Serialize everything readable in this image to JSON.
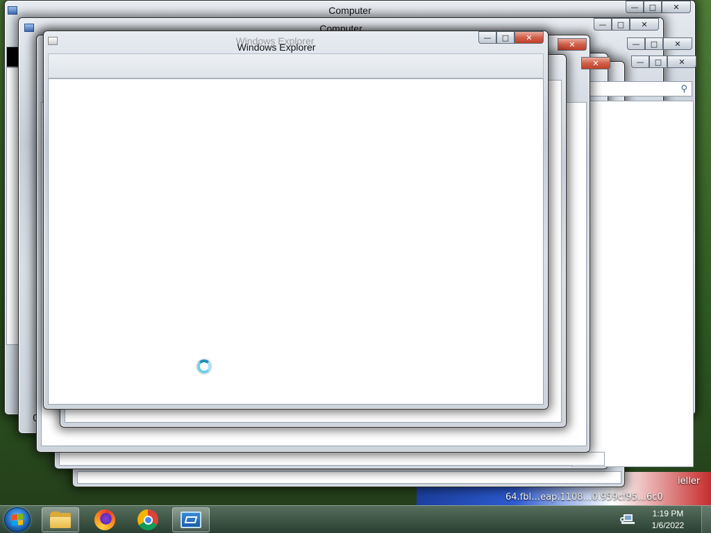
{
  "windows": {
    "back_title": "Computer",
    "second_title": "Computer",
    "ghost_title": "Windows Explorer",
    "front_title": "Windows Explorer"
  },
  "caption": {
    "minimize": "—",
    "maximize": "□",
    "close": "✕"
  },
  "desktop": {
    "partial_text_1": "ieller",
    "partial_text_2": "64.fbl…eap.1108…0.959cf95…6c0",
    "partial_text_3": "0"
  },
  "taskbar": {
    "time": "1:19 PM",
    "date": "1/6/2022",
    "pinned": [
      {
        "name": "Windows Explorer",
        "icon": "folder-icon"
      },
      {
        "name": "Firefox",
        "icon": "firefox-icon"
      },
      {
        "name": "Google Chrome",
        "icon": "chrome-icon"
      },
      {
        "name": "Remote Desktop Connection",
        "icon": "remote-desktop-icon"
      }
    ]
  },
  "colors": {
    "close_red": "#c0402a",
    "busy_cursor": "#6fd0e8"
  }
}
